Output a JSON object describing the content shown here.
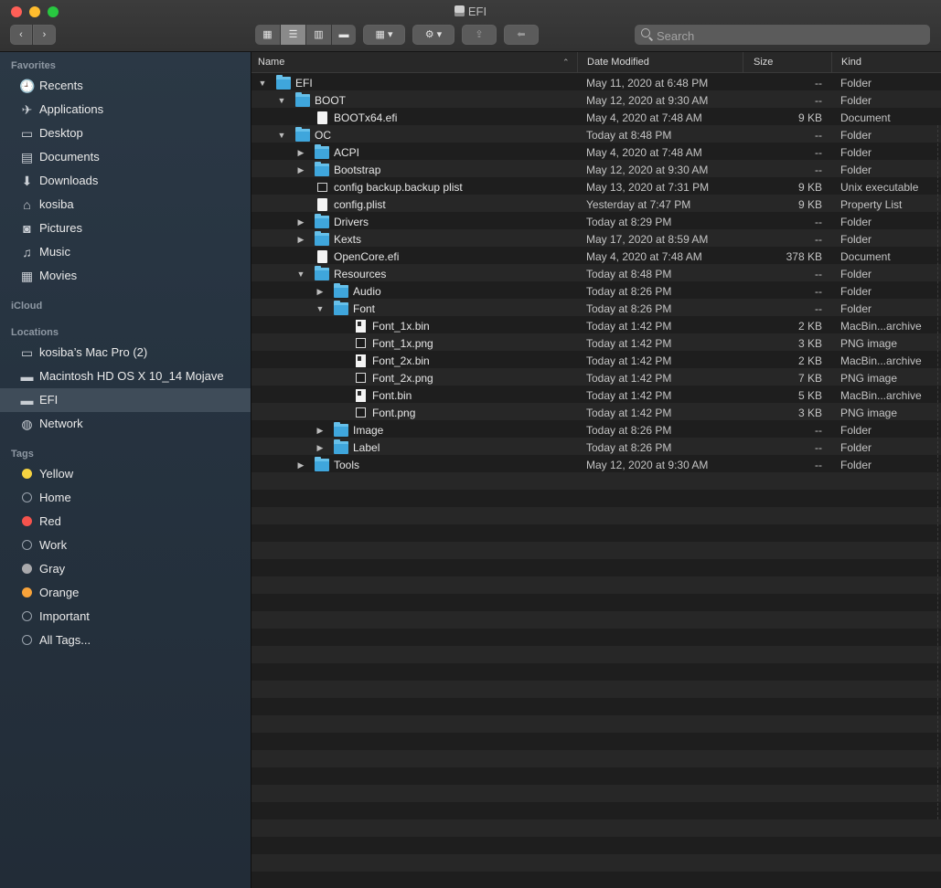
{
  "window": {
    "title": "EFI"
  },
  "toolbar": {
    "back_glyph": "‹",
    "forward_glyph": "›",
    "view_icons": [
      "▦",
      "☰",
      "▥",
      "▬"
    ],
    "group_glyph": "▦ ▾",
    "gear_glyph": "⚙ ▾",
    "share_glyph": "⇪",
    "tag_glyph": "⬅",
    "search_placeholder": "Search"
  },
  "sidebar": {
    "favorites_title": "Favorites",
    "favorites": [
      {
        "label": "Recents",
        "icon": "clock-icon",
        "glyph": "🕘"
      },
      {
        "label": "Applications",
        "icon": "applications-icon",
        "glyph": "✈"
      },
      {
        "label": "Desktop",
        "icon": "desktop-icon",
        "glyph": "▭"
      },
      {
        "label": "Documents",
        "icon": "documents-icon",
        "glyph": "▤"
      },
      {
        "label": "Downloads",
        "icon": "downloads-icon",
        "glyph": "⬇"
      },
      {
        "label": "kosiba",
        "icon": "home-icon",
        "glyph": "⌂"
      },
      {
        "label": "Pictures",
        "icon": "camera-icon",
        "glyph": "◙"
      },
      {
        "label": "Music",
        "icon": "music-icon",
        "glyph": "♫"
      },
      {
        "label": "Movies",
        "icon": "movies-icon",
        "glyph": "▦"
      }
    ],
    "icloud_title": "iCloud",
    "locations_title": "Locations",
    "locations": [
      {
        "label": "kosiba’s Mac Pro (2)",
        "icon": "computer-icon",
        "glyph": "▭"
      },
      {
        "label": "Macintosh HD OS X 10_14 Mojave",
        "icon": "disk-icon",
        "glyph": "▬"
      },
      {
        "label": "EFI",
        "icon": "disk-icon",
        "glyph": "▬"
      },
      {
        "label": "Network",
        "icon": "network-icon",
        "glyph": "◍"
      }
    ],
    "tags_title": "Tags",
    "tags": [
      {
        "label": "Yellow",
        "color": "#f6d341"
      },
      {
        "label": "Home",
        "color": ""
      },
      {
        "label": "Red",
        "color": "#f5534d"
      },
      {
        "label": "Work",
        "color": ""
      },
      {
        "label": "Gray",
        "color": "#a9a9ac"
      },
      {
        "label": "Orange",
        "color": "#f8a33a"
      },
      {
        "label": "Important",
        "color": ""
      },
      {
        "label": "All Tags...",
        "color": ""
      }
    ]
  },
  "columns": {
    "name": "Name",
    "date": "Date Modified",
    "size": "Size",
    "kind": "Kind"
  },
  "files": [
    {
      "name": "EFI",
      "date": "May 11, 2020 at 6:48 PM",
      "size": "--",
      "kind": "Folder",
      "depth": 0,
      "type": "folder",
      "disclosure": "open"
    },
    {
      "name": "BOOT",
      "date": "May 12, 2020 at 9:30 AM",
      "size": "--",
      "kind": "Folder",
      "depth": 1,
      "type": "folder",
      "disclosure": "open"
    },
    {
      "name": "BOOTx64.efi",
      "date": "May 4, 2020 at 7:48 AM",
      "size": "9 KB",
      "kind": "Document",
      "depth": 2,
      "type": "doc",
      "disclosure": ""
    },
    {
      "name": "OC",
      "date": "Today at 8:48 PM",
      "size": "--",
      "kind": "Folder",
      "depth": 1,
      "type": "folder",
      "disclosure": "open"
    },
    {
      "name": "ACPI",
      "date": "May 4, 2020 at 7:48 AM",
      "size": "--",
      "kind": "Folder",
      "depth": 2,
      "type": "folder",
      "disclosure": "closed"
    },
    {
      "name": "Bootstrap",
      "date": "May 12, 2020 at 9:30 AM",
      "size": "--",
      "kind": "Folder",
      "depth": 2,
      "type": "folder",
      "disclosure": "closed"
    },
    {
      "name": "config backup.backup plist",
      "date": "May 13, 2020 at 7:31 PM",
      "size": "9 KB",
      "kind": "Unix executable",
      "depth": 2,
      "type": "exec",
      "disclosure": ""
    },
    {
      "name": "config.plist",
      "date": "Yesterday at 7:47 PM",
      "size": "9 KB",
      "kind": "Property List",
      "depth": 2,
      "type": "doc",
      "disclosure": ""
    },
    {
      "name": "Drivers",
      "date": "Today at 8:29 PM",
      "size": "--",
      "kind": "Folder",
      "depth": 2,
      "type": "folder",
      "disclosure": "closed"
    },
    {
      "name": "Kexts",
      "date": "May 17, 2020 at 8:59 AM",
      "size": "--",
      "kind": "Folder",
      "depth": 2,
      "type": "folder",
      "disclosure": "closed"
    },
    {
      "name": "OpenCore.efi",
      "date": "May 4, 2020 at 7:48 AM",
      "size": "378 KB",
      "kind": "Document",
      "depth": 2,
      "type": "doc",
      "disclosure": ""
    },
    {
      "name": "Resources",
      "date": "Today at 8:48 PM",
      "size": "--",
      "kind": "Folder",
      "depth": 2,
      "type": "folder",
      "disclosure": "open"
    },
    {
      "name": "Audio",
      "date": "Today at 8:26 PM",
      "size": "--",
      "kind": "Folder",
      "depth": 3,
      "type": "folder",
      "disclosure": "closed"
    },
    {
      "name": "Font",
      "date": "Today at 8:26 PM",
      "size": "--",
      "kind": "Folder",
      "depth": 3,
      "type": "folder",
      "disclosure": "open"
    },
    {
      "name": "Font_1x.bin",
      "date": "Today at 1:42 PM",
      "size": "2 KB",
      "kind": "MacBin...archive",
      "depth": 4,
      "type": "bin",
      "disclosure": ""
    },
    {
      "name": "Font_1x.png",
      "date": "Today at 1:42 PM",
      "size": "3 KB",
      "kind": "PNG image",
      "depth": 4,
      "type": "img",
      "disclosure": ""
    },
    {
      "name": "Font_2x.bin",
      "date": "Today at 1:42 PM",
      "size": "2 KB",
      "kind": "MacBin...archive",
      "depth": 4,
      "type": "bin",
      "disclosure": ""
    },
    {
      "name": "Font_2x.png",
      "date": "Today at 1:42 PM",
      "size": "7 KB",
      "kind": "PNG image",
      "depth": 4,
      "type": "img",
      "disclosure": ""
    },
    {
      "name": "Font.bin",
      "date": "Today at 1:42 PM",
      "size": "5 KB",
      "kind": "MacBin...archive",
      "depth": 4,
      "type": "bin",
      "disclosure": ""
    },
    {
      "name": "Font.png",
      "date": "Today at 1:42 PM",
      "size": "3 KB",
      "kind": "PNG image",
      "depth": 4,
      "type": "img",
      "disclosure": ""
    },
    {
      "name": "Image",
      "date": "Today at 8:26 PM",
      "size": "--",
      "kind": "Folder",
      "depth": 3,
      "type": "folder",
      "disclosure": "closed"
    },
    {
      "name": "Label",
      "date": "Today at 8:26 PM",
      "size": "--",
      "kind": "Folder",
      "depth": 3,
      "type": "folder",
      "disclosure": "closed"
    },
    {
      "name": "Tools",
      "date": "May 12, 2020 at 9:30 AM",
      "size": "--",
      "kind": "Folder",
      "depth": 2,
      "type": "folder",
      "disclosure": "closed"
    }
  ]
}
